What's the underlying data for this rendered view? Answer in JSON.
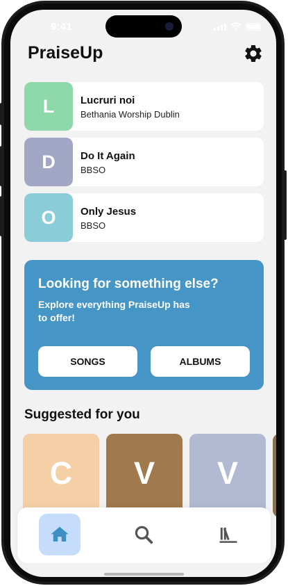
{
  "status_bar": {
    "time": "9:41"
  },
  "header": {
    "title": "PraiseUp",
    "settings_icon": "gear-icon"
  },
  "recent": [
    {
      "letter": "L",
      "title": "Lucruri noi",
      "artist": "Bethania Worship Dublin",
      "color": "#8fd8aa"
    },
    {
      "letter": "D",
      "title": "Do It Again",
      "artist": "BBSO",
      "color": "#a1a7c4"
    },
    {
      "letter": "O",
      "title": "Only Jesus",
      "artist": "BBSO",
      "color": "#8acdd9"
    }
  ],
  "explore": {
    "title": "Looking for something else?",
    "subtitle": "Explore everything PraiseUp has to offer!",
    "songs_label": "SONGS",
    "albums_label": "ALBUMS",
    "color": "#4596c6"
  },
  "suggested": {
    "title": "Suggested for you",
    "items": [
      {
        "letter": "C",
        "color": "#f5cfa6"
      },
      {
        "letter": "V",
        "color": "#a07a4c"
      },
      {
        "letter": "V",
        "color": "#b2b9d3"
      },
      {
        "letter": "",
        "color": "#8d6e45"
      }
    ]
  },
  "tab_bar": {
    "items": [
      {
        "icon": "home-icon",
        "active": true
      },
      {
        "icon": "search-icon",
        "active": false
      },
      {
        "icon": "library-icon",
        "active": false
      }
    ],
    "active_color": "#c6dcfb",
    "icon_active_color": "#3e8fc4",
    "icon_inactive_color": "#555555"
  }
}
